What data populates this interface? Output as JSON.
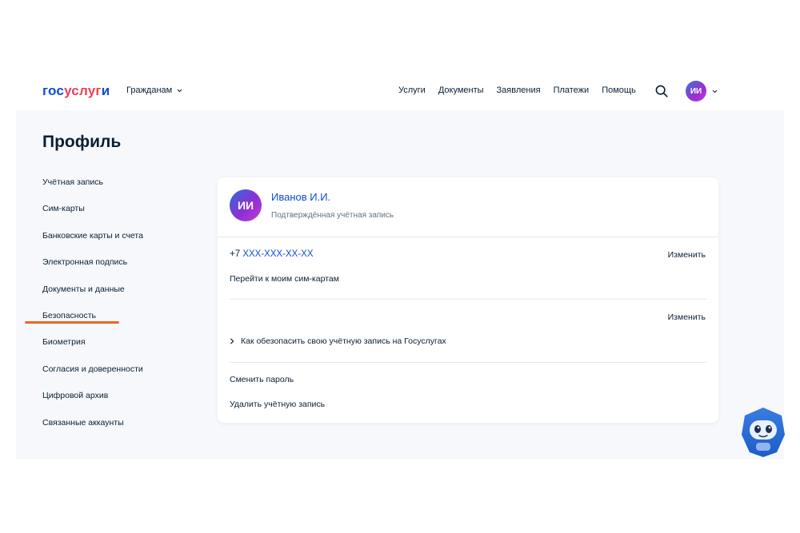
{
  "header": {
    "logo_part1": "гос",
    "logo_part2": "услуг",
    "logo_part3": "и",
    "audience": "Гражданам",
    "nav": [
      "Услуги",
      "Документы",
      "Заявления",
      "Платежи",
      "Помощь"
    ],
    "avatar_initials": "ИИ"
  },
  "page": {
    "title": "Профиль"
  },
  "sidebar": {
    "items": [
      "Учётная запись",
      "Сим-карты",
      "Банковские карты и счета",
      "Электронная подпись",
      "Документы и данные",
      "Безопасность",
      "Биометрия",
      "Согласия и доверенности",
      "Цифровой архив",
      "Связанные аккаунты"
    ],
    "active_index": 5
  },
  "card": {
    "avatar_initials": "ИИ",
    "user_name": "Иванов И.И.",
    "user_status": "Подтверждённая учётная запись",
    "phone_prefix": "+7",
    "phone_number": "XXX-XXX-XX-XX",
    "edit_label": "Изменить",
    "sim_link": "Перейти к моим сим-картам",
    "edit_label_2": "Изменить",
    "secure_link": "Как обезопасить свою учётную запись на Госуслугах",
    "change_password": "Сменить пароль",
    "delete_account": "Удалить учётную запись"
  },
  "icons": {
    "search": "search-icon",
    "chevron": "chevron-down-icon",
    "chevron_right": "chevron-right-icon",
    "robot": "robot-assistant-icon"
  },
  "colors": {
    "brand_blue": "#0d4cd3",
    "brand_red": "#ee3f58",
    "accent_orange": "#f26422",
    "page_bg": "#f6f8fb"
  }
}
